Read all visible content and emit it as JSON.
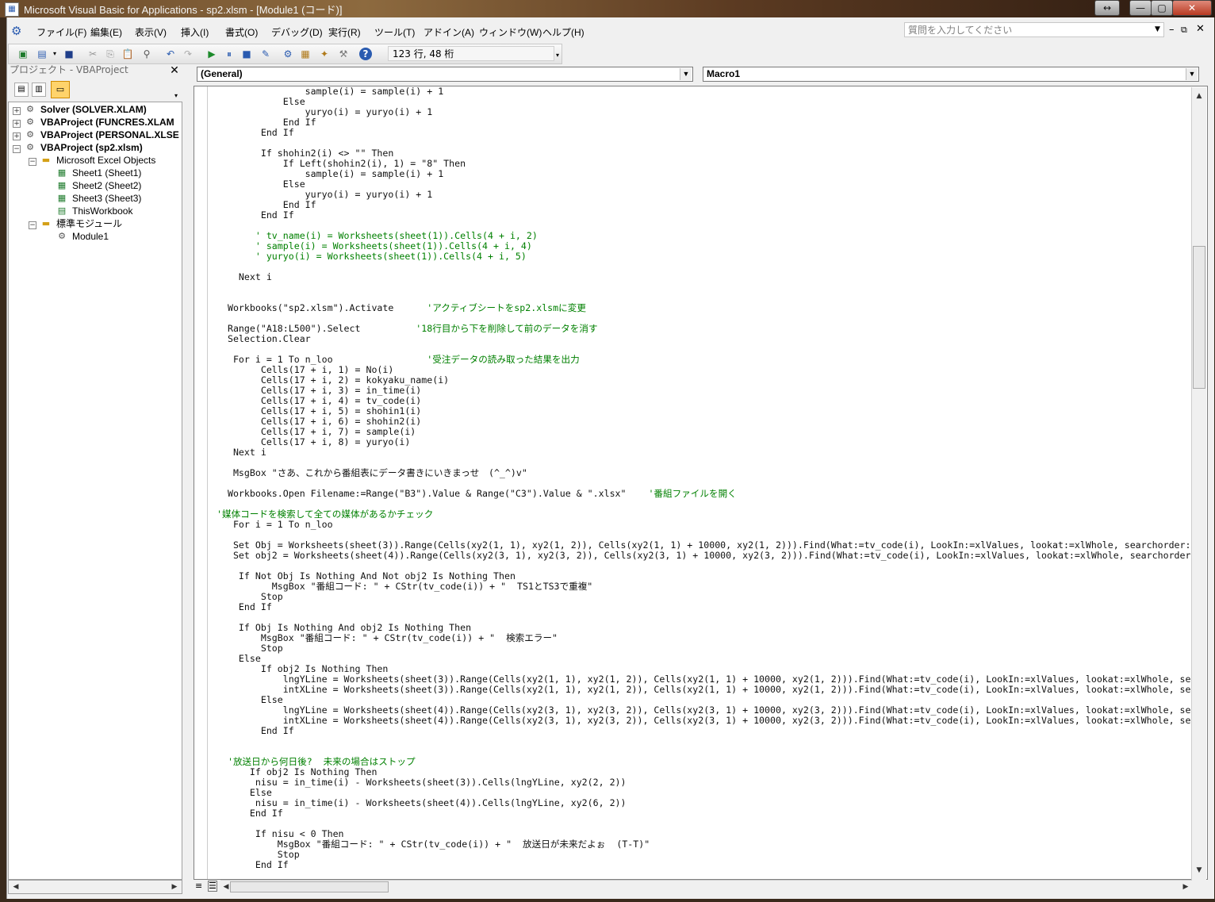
{
  "window": {
    "title": "Microsoft Visual Basic for Applications - sp2.xlsm - [Module1 (コード)]",
    "controls": [
      "↔",
      "—",
      "▢",
      "✕"
    ]
  },
  "menu": [
    "ファイル(F)",
    "編集(E)",
    "表示(V)",
    "挿入(I)",
    "書式(O)",
    "デバッグ(D)",
    "実行(R)",
    "ツール(T)",
    "アドイン(A)",
    "ウィンドウ(W)",
    "ヘルプ(H)"
  ],
  "help_placeholder": "質問を入力してください",
  "toolbar": {
    "position": "123 行, 48 桁"
  },
  "project": {
    "title": "プロジェクト - VBAProject",
    "nodes": [
      "Solver (SOLVER.XLAM)",
      "VBAProject (FUNCRES.XLAM",
      "VBAProject (PERSONAL.XLSE",
      "VBAProject (sp2.xlsm)",
      "Microsoft Excel Objects",
      "Sheet1 (Sheet1)",
      "Sheet2 (Sheet2)",
      "Sheet3 (Sheet3)",
      "ThisWorkbook",
      "標準モジュール",
      "Module1"
    ]
  },
  "editor": {
    "object_dropdown": "(General)",
    "proc_dropdown": "Macro1",
    "lines": [
      {
        "t": "                sample(i) = sample(i) + 1",
        "c": 0
      },
      {
        "t": "            Else",
        "c": 0
      },
      {
        "t": "                yuryo(i) = yuryo(i) + 1",
        "c": 0
      },
      {
        "t": "            End If",
        "c": 0
      },
      {
        "t": "        End If",
        "c": 0
      },
      {
        "t": "",
        "c": 0
      },
      {
        "t": "        If shohin2(i) <> \"\" Then",
        "c": 0
      },
      {
        "t": "            If Left(shohin2(i), 1) = \"8\" Then",
        "c": 0
      },
      {
        "t": "                sample(i) = sample(i) + 1",
        "c": 0
      },
      {
        "t": "            Else",
        "c": 0
      },
      {
        "t": "                yuryo(i) = yuryo(i) + 1",
        "c": 0
      },
      {
        "t": "            End If",
        "c": 0
      },
      {
        "t": "        End If",
        "c": 0
      },
      {
        "t": "",
        "c": 0
      },
      {
        "t": "       ' tv_name(i) = Worksheets(sheet(1)).Cells(4 + i, 2)",
        "c": 1
      },
      {
        "t": "       ' sample(i) = Worksheets(sheet(1)).Cells(4 + i, 4)",
        "c": 1
      },
      {
        "t": "       ' yuryo(i) = Worksheets(sheet(1)).Cells(4 + i, 5)",
        "c": 1
      },
      {
        "t": "",
        "c": 0
      },
      {
        "t": "    Next i",
        "c": 0
      },
      {
        "t": "",
        "c": 0
      },
      {
        "t": "",
        "c": 0
      },
      {
        "t": "  Workbooks(\"sp2.xlsm\").Activate      'アクティブシートをsp2.xlsmに変更",
        "c": 0
      },
      {
        "t": "",
        "c": 0
      },
      {
        "t": "  Range(\"A18:L500\").Select          '18行目から下を削除して前のデータを消す",
        "c": 0
      },
      {
        "t": "  Selection.Clear",
        "c": 0
      },
      {
        "t": "",
        "c": 0
      },
      {
        "t": "   For i = 1 To n_loo                 '受注データの読み取った結果を出力",
        "c": 0
      },
      {
        "t": "        Cells(17 + i, 1) = No(i)",
        "c": 0
      },
      {
        "t": "        Cells(17 + i, 2) = kokyaku_name(i)",
        "c": 0
      },
      {
        "t": "        Cells(17 + i, 3) = in_time(i)",
        "c": 0
      },
      {
        "t": "        Cells(17 + i, 4) = tv_code(i)",
        "c": 0
      },
      {
        "t": "        Cells(17 + i, 5) = shohin1(i)",
        "c": 0
      },
      {
        "t": "        Cells(17 + i, 6) = shohin2(i)",
        "c": 0
      },
      {
        "t": "        Cells(17 + i, 7) = sample(i)",
        "c": 0
      },
      {
        "t": "        Cells(17 + i, 8) = yuryo(i)",
        "c": 0
      },
      {
        "t": "   Next i",
        "c": 0
      },
      {
        "t": "",
        "c": 0
      },
      {
        "t": "   MsgBox \"さあ、これから番組表にデータ書きにいきまっせ　(^_^)v\"",
        "c": 0
      },
      {
        "t": "",
        "c": 0
      },
      {
        "t": "  Workbooks.Open Filename:=Range(\"B3\").Value & Range(\"C3\").Value & \".xlsx\"    '番組ファイルを開く",
        "c": 0
      },
      {
        "t": "",
        "c": 0
      },
      {
        "t": "'媒体コードを検索して全ての媒体があるかチェック",
        "c": 0
      },
      {
        "t": "   For i = 1 To n_loo",
        "c": 0
      },
      {
        "t": "",
        "c": 0
      },
      {
        "t": "   Set Obj = Worksheets(sheet(3)).Range(Cells(xy2(1, 1), xy2(1, 2)), Cells(xy2(1, 1) + 10000, xy2(1, 2))).Find(What:=tv_code(i), LookIn:=xlValues, lookat:=xlWhole, searchorder:",
        "c": 0
      },
      {
        "t": "   Set obj2 = Worksheets(sheet(4)).Range(Cells(xy2(3, 1), xy2(3, 2)), Cells(xy2(3, 1) + 10000, xy2(3, 2))).Find(What:=tv_code(i), LookIn:=xlValues, lookat:=xlWhole, searchorder",
        "c": 0
      },
      {
        "t": "",
        "c": 0
      },
      {
        "t": "    If Not Obj Is Nothing And Not obj2 Is Nothing Then",
        "c": 0
      },
      {
        "t": "          MsgBox \"番組コード: \" + CStr(tv_code(i)) + \"  TS1とTS3で重複\"",
        "c": 0
      },
      {
        "t": "        Stop",
        "c": 0
      },
      {
        "t": "    End If",
        "c": 0
      },
      {
        "t": "",
        "c": 0
      },
      {
        "t": "    If Obj Is Nothing And obj2 Is Nothing Then",
        "c": 0
      },
      {
        "t": "        MsgBox \"番組コード: \" + CStr(tv_code(i)) + \"  検索エラー\"",
        "c": 0
      },
      {
        "t": "        Stop",
        "c": 0
      },
      {
        "t": "    Else",
        "c": 0
      },
      {
        "t": "        If obj2 Is Nothing Then",
        "c": 0
      },
      {
        "t": "            lngYLine = Worksheets(sheet(3)).Range(Cells(xy2(1, 1), xy2(1, 2)), Cells(xy2(1, 1) + 10000, xy2(1, 2))).Find(What:=tv_code(i), LookIn:=xlValues, lookat:=xlWhole, se",
        "c": 0
      },
      {
        "t": "            intXLine = Worksheets(sheet(3)).Range(Cells(xy2(1, 1), xy2(1, 2)), Cells(xy2(1, 1) + 10000, xy2(1, 2))).Find(What:=tv_code(i), LookIn:=xlValues, lookat:=xlWhole, se",
        "c": 0
      },
      {
        "t": "        Else",
        "c": 0
      },
      {
        "t": "            lngYLine = Worksheets(sheet(4)).Range(Cells(xy2(3, 1), xy2(3, 2)), Cells(xy2(3, 1) + 10000, xy2(3, 2))).Find(What:=tv_code(i), LookIn:=xlValues, lookat:=xlWhole, se",
        "c": 0
      },
      {
        "t": "            intXLine = Worksheets(sheet(4)).Range(Cells(xy2(3, 1), xy2(3, 2)), Cells(xy2(3, 1) + 10000, xy2(3, 2))).Find(What:=tv_code(i), LookIn:=xlValues, lookat:=xlWhole, se",
        "c": 0
      },
      {
        "t": "        End If",
        "c": 0
      },
      {
        "t": "",
        "c": 0
      },
      {
        "t": "",
        "c": 0
      },
      {
        "t": "  '放送日から何日後?  未来の場合はストップ",
        "c": 1
      },
      {
        "t": "      If obj2 Is Nothing Then",
        "c": 0
      },
      {
        "t": "       nisu = in_time(i) - Worksheets(sheet(3)).Cells(lngYLine, xy2(2, 2))",
        "c": 0
      },
      {
        "t": "      Else",
        "c": 0
      },
      {
        "t": "       nisu = in_time(i) - Worksheets(sheet(4)).Cells(lngYLine, xy2(6, 2))",
        "c": 0
      },
      {
        "t": "      End If",
        "c": 0
      },
      {
        "t": "",
        "c": 0
      },
      {
        "t": "       If nisu < 0 Then",
        "c": 0
      },
      {
        "t": "           MsgBox \"番組コード: \" + CStr(tv_code(i)) + \"  放送日が未来だよぉ  (T-T)\"",
        "c": 0
      },
      {
        "t": "           Stop",
        "c": 0
      },
      {
        "t": "       End If",
        "c": 0
      }
    ]
  }
}
